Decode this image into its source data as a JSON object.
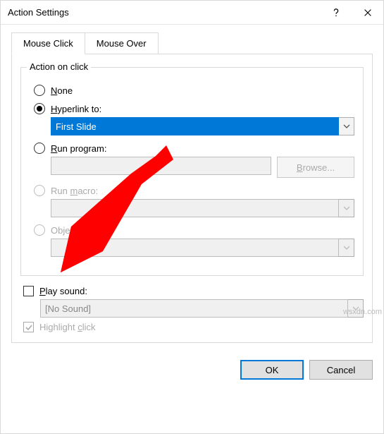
{
  "title": "Action Settings",
  "tabs": {
    "mouse_click": "Mouse Click",
    "mouse_over": "Mouse Over"
  },
  "group": {
    "legend": "Action on click"
  },
  "radio": {
    "none": "None",
    "hyperlink": "Hyperlink to:",
    "run_program": "Run program:",
    "run_macro": "Run macro:",
    "object_action": "Object action:"
  },
  "hyperlink_value": "First Slide",
  "browse": "Browse...",
  "play_sound": "Play sound:",
  "sound_value": "[No Sound]",
  "highlight_click": "Highlight click",
  "buttons": {
    "ok": "OK",
    "cancel": "Cancel"
  },
  "watermark": "wsxdn.com"
}
